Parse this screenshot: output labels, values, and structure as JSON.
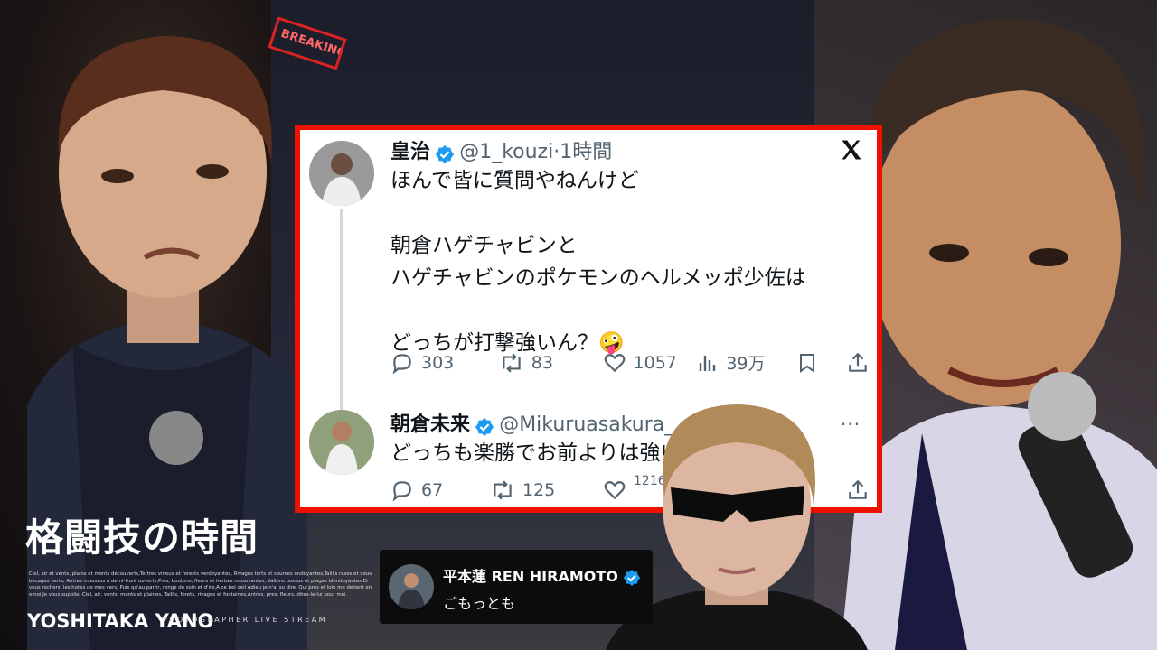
{
  "tweet": {
    "author_name": "皇治",
    "author_handle": "@1_kouzi",
    "time": "·1時間",
    "lines": [
      "ほんで皆に質問やねんけど",
      "朝倉ハゲチャビンと",
      "ハゲチャビンのポケモンのヘルメッポ少佐は",
      "どっちが打撃強いん？🤪"
    ],
    "replies": "303",
    "reposts": "83",
    "likes": "1057",
    "views": "39万"
  },
  "reply": {
    "author_name": "朝倉未来",
    "author_handle": "@Mikuruasakura_",
    "text": "どっちも楽勝でお前よりは強い",
    "replies": "67",
    "reposts": "125",
    "likes": "1216"
  },
  "comment_card": {
    "author_name": "平本蓮 REN HIRAMOTO",
    "text": "ごもっとも"
  },
  "branding": {
    "title": "格闘技の時間",
    "small_print": "Ciel, air et vents, plains et monts découverts,Tertres vineux et forests verdoyantes, Rivages torts et sources ondoyantes,Taillis rases et vous bocages verts, Antres moussus a demi-front ouverts,Pres, boutons, fleurs et herbes rousoyantes, Vallons bossus et plages blondoyantes,Et vous rochers, les hotes de mes vers, Puis qu'au partir, ronge de soin et d'ire,A ce bel oeil Adieu je n'ai su dire, Qui pres et loin me detient en emoi,Je vous supplie, Ciel, air, vents, monts et plaines, Taillis, forets, rivages et fontaines,Antres, pres, fleurs, dites-le-lui pour moi.",
    "name": "YOSHITAKA YANO",
    "sub": "PHOTOGRAPHER LIVE STREAM"
  },
  "neon_sign": "BREAKING DO",
  "colors": {
    "frame_red": "#e10",
    "verified_blue": "#1d9bf0",
    "text_dark": "#0f1419",
    "text_gray": "#536471"
  },
  "icons": [
    "x-logo-icon",
    "verified-icon",
    "reply-icon",
    "repost-icon",
    "like-icon",
    "views-icon",
    "bookmark-icon",
    "share-icon",
    "more-icon"
  ]
}
